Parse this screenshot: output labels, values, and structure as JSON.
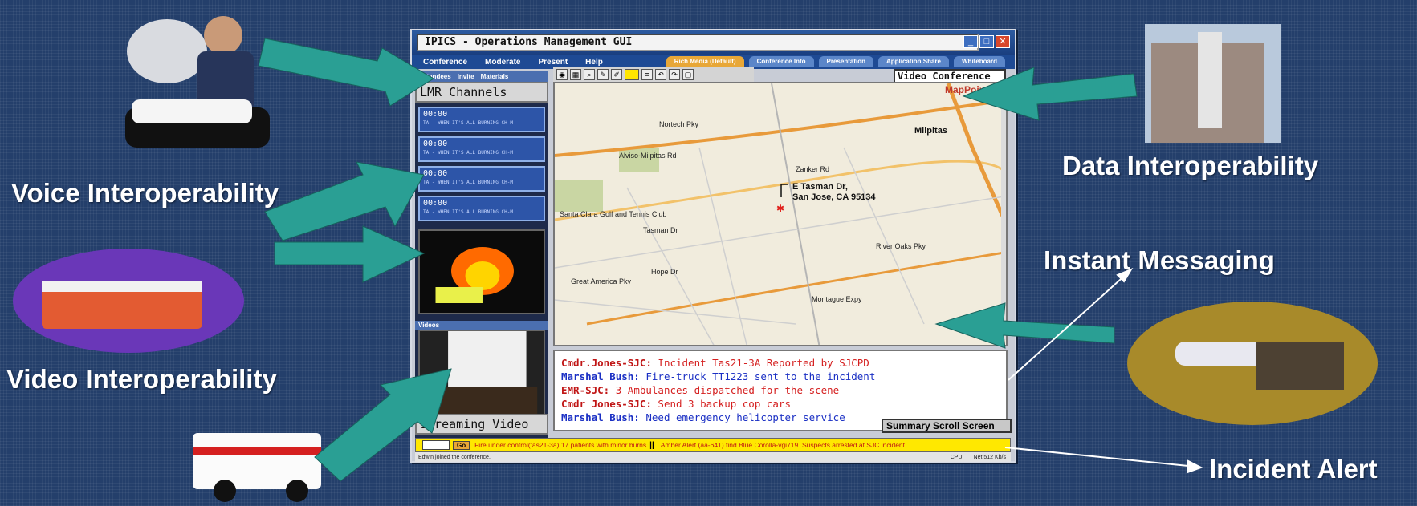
{
  "labels": {
    "voice": "Voice Interoperability",
    "video": "Video Interoperability",
    "data": "Data Interoperability",
    "im": "Instant Messaging",
    "alert": "Incident Alert"
  },
  "window": {
    "title": "IPICS - Operations Management GUI",
    "menu": [
      "Conference",
      "Moderate",
      "Present",
      "Help"
    ],
    "tabs": [
      "Rich Media (Default)",
      "Conference Info",
      "Presentation",
      "Application Share",
      "Whiteboard"
    ],
    "subtabs": [
      "Attendees",
      "Invite",
      "Materials"
    ],
    "lmr_title": "LMR Channels",
    "channels": [
      {
        "time": "00:00",
        "status": "TA - WHEN IT'S ALL BURNING CH-M"
      },
      {
        "time": "00:00",
        "status": "TA - WHEN IT'S ALL BURNING CH-M"
      },
      {
        "time": "00:00",
        "status": "TA - WHEN IT'S ALL BURNING CH-M"
      },
      {
        "time": "00:00",
        "status": "TA - WHEN IT'S ALL BURNING CH-M"
      }
    ],
    "videos_label": "Videos",
    "stream_label": "Streaming Video",
    "vc_label": "Video Conference",
    "map_brand": "MapPoint",
    "map_address": [
      "E Tasman Dr,",
      "San Jose, CA 95134"
    ],
    "map_streets": [
      "Nortech Pky",
      "Alviso-Milpitas Rd",
      "Milpitas",
      "Tasman Dr",
      "Montague Expy",
      "Santa Clara Golf and Tennis Club",
      "Zanker Rd",
      "Hope Dr",
      "River Oaks Pky",
      "Great America Pky"
    ],
    "chat": [
      {
        "who": "Cmdr.Jones-SJC:",
        "msg": "Incident Tas21-3A Reported by SJCPD",
        "who_color": "red",
        "msg_color": "red"
      },
      {
        "who": "Marshal Bush:",
        "msg": "Fire-truck TT1223 sent to the incident",
        "who_color": "blue",
        "msg_color": "blue"
      },
      {
        "who": "EMR-SJC:",
        "msg": "3 Ambulances dispatched for the scene",
        "who_color": "red",
        "msg_color": "red"
      },
      {
        "who": "Cmdr Jones-SJC:",
        "msg": "Send 3 backup cop cars",
        "who_color": "red",
        "msg_color": "red"
      },
      {
        "who": "Marshal Bush:",
        "msg": "Need emergency helicopter service",
        "who_color": "blue",
        "msg_color": "blue"
      }
    ],
    "summary_label": "Summary Scroll Screen",
    "ticker_go": "Go",
    "ticker_a": "Fire under control(tas21-3a) 17 patients with minor burns",
    "ticker_b": "Amber Alert (aa-641) find Blue Corolla-vgi719. Suspects arrested at SJC incident",
    "status_left": "Edwin joined the conference.",
    "status_cpu": "CPU",
    "status_net": "Net 512 Kb/s"
  },
  "colors": {
    "bg": "#243f6b",
    "arrow": "#2a9f94",
    "label": "#ffffff"
  }
}
